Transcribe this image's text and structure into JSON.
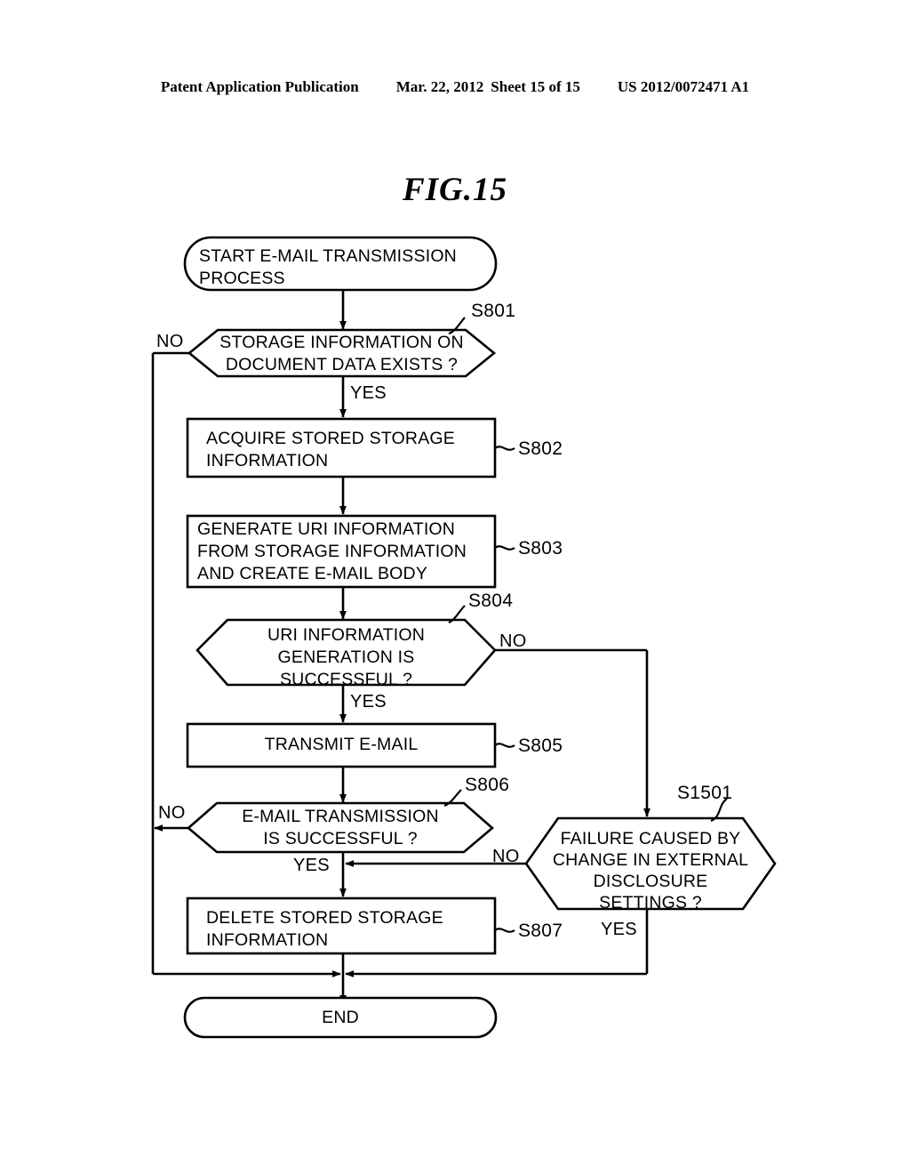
{
  "header": {
    "publication": "Patent Application Publication",
    "date": "Mar. 22, 2012",
    "sheet": "Sheet 15 of 15",
    "number": "US 2012/0072471 A1"
  },
  "figure": {
    "title": "FIG.15"
  },
  "flowchart": {
    "nodes": {
      "start": {
        "shape": "stadium",
        "line1": "START E-MAIL TRANSMISSION",
        "line2": "PROCESS"
      },
      "s801": {
        "shape": "hexagon",
        "step": "S801",
        "line1": "STORAGE INFORMATION ON",
        "line2": "DOCUMENT DATA EXISTS ?"
      },
      "s802": {
        "shape": "process",
        "step": "S802",
        "line1": "ACQUIRE STORED STORAGE",
        "line2": "INFORMATION"
      },
      "s803": {
        "shape": "process",
        "step": "S803",
        "line1": "GENERATE URI INFORMATION",
        "line2": "FROM STORAGE INFORMATION",
        "line3": "AND CREATE E-MAIL BODY"
      },
      "s804": {
        "shape": "hexagon",
        "step": "S804",
        "line1": "URI INFORMATION",
        "line2": "GENERATION IS",
        "line3": "SUCCESSFUL ?"
      },
      "s805": {
        "shape": "process",
        "step": "S805",
        "line1": "TRANSMIT E-MAIL"
      },
      "s806": {
        "shape": "hexagon",
        "step": "S806",
        "line1": "E-MAIL TRANSMISSION",
        "line2": "IS SUCCESSFUL ?"
      },
      "s1501": {
        "shape": "hexagon",
        "step": "S1501",
        "line1": "FAILURE CAUSED BY",
        "line2": "CHANGE IN EXTERNAL",
        "line3": "DISCLOSURE",
        "line4": "SETTINGS ?"
      },
      "s807": {
        "shape": "process",
        "step": "S807",
        "line1": "DELETE STORED STORAGE",
        "line2": "INFORMATION"
      },
      "end": {
        "shape": "stadium",
        "line1": "END"
      }
    },
    "branches": {
      "s801_no": "NO",
      "s801_yes": "YES",
      "s804_no": "NO",
      "s804_yes": "YES",
      "s806_no": "NO",
      "s806_yes": "YES",
      "s1501_no": "NO",
      "s1501_yes": "YES"
    },
    "colors": {
      "stroke": "#000000",
      "fill": "#ffffff",
      "background": "#ffffff"
    }
  }
}
